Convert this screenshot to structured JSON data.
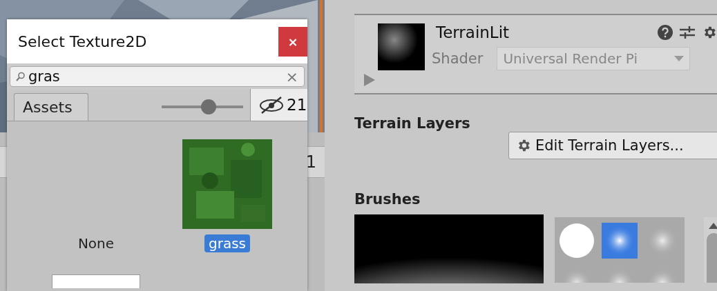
{
  "background": {
    "row_text": "1"
  },
  "dialog": {
    "title": "Select Texture2D",
    "close": "×",
    "search": {
      "value": "gras",
      "clear": "×"
    },
    "tabs": [
      {
        "label": "Assets",
        "selected": true
      }
    ],
    "zoom": {
      "level": 0.58
    },
    "hidden_count": "21",
    "items": [
      {
        "kind": "none",
        "label": "None",
        "selected": false
      },
      {
        "kind": "texture",
        "label": "grass",
        "selected": true
      },
      {
        "kind": "blank"
      }
    ]
  },
  "inspector": {
    "material": {
      "name": "TerrainLit",
      "shader_label": "Shader",
      "shader_value": "Universal Render Pi"
    },
    "terrain_layers": {
      "title": "Terrain Layers",
      "button": "Edit Terrain Layers..."
    },
    "brushes": {
      "title": "Brushes",
      "items": [
        {
          "kind": "hard",
          "selected": false
        },
        {
          "kind": "soft",
          "selected": true
        },
        {
          "kind": "faint",
          "selected": false
        },
        {
          "kind": "faint",
          "selected": false
        },
        {
          "kind": "faint",
          "selected": false
        },
        {
          "kind": "faint",
          "selected": false
        }
      ]
    }
  }
}
